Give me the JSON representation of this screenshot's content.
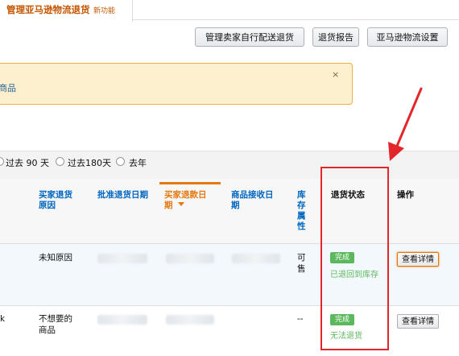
{
  "tab": {
    "label": "管理亚马逊物流退货",
    "badge": "新功能"
  },
  "toolbar": {
    "manage_self_ship": "管理卖家自行配送退货",
    "return_report": "退货报告",
    "fba_settings": "亚马逊物流设置"
  },
  "alert": {
    "text": "商品",
    "close": "×"
  },
  "filter": {
    "options": [
      "过去 90 天",
      "过去180天",
      "去年"
    ]
  },
  "table": {
    "headers": {
      "reason": "买家退货原因",
      "approve_date": "批准退货日期",
      "refund_date": "买家退款日期",
      "receive_date": "商品接收日期",
      "inventory": "库存属性",
      "status": "退货状态",
      "action": "操作"
    },
    "rows": [
      {
        "left_text": "",
        "reason": "未知原因",
        "inventory": "可售",
        "status_badge": "完成",
        "status_text": "已退回到库存",
        "action": "查看详情"
      },
      {
        "left_text": "k",
        "reason": "不想要的商品",
        "inventory": "--",
        "status_badge": "完成",
        "status_text": "无法退货",
        "action": "查看详情"
      }
    ]
  },
  "colors": {
    "accent": "#c45500",
    "link": "#0066c0",
    "success": "#5cb85c",
    "highlight": "#e3262a"
  }
}
